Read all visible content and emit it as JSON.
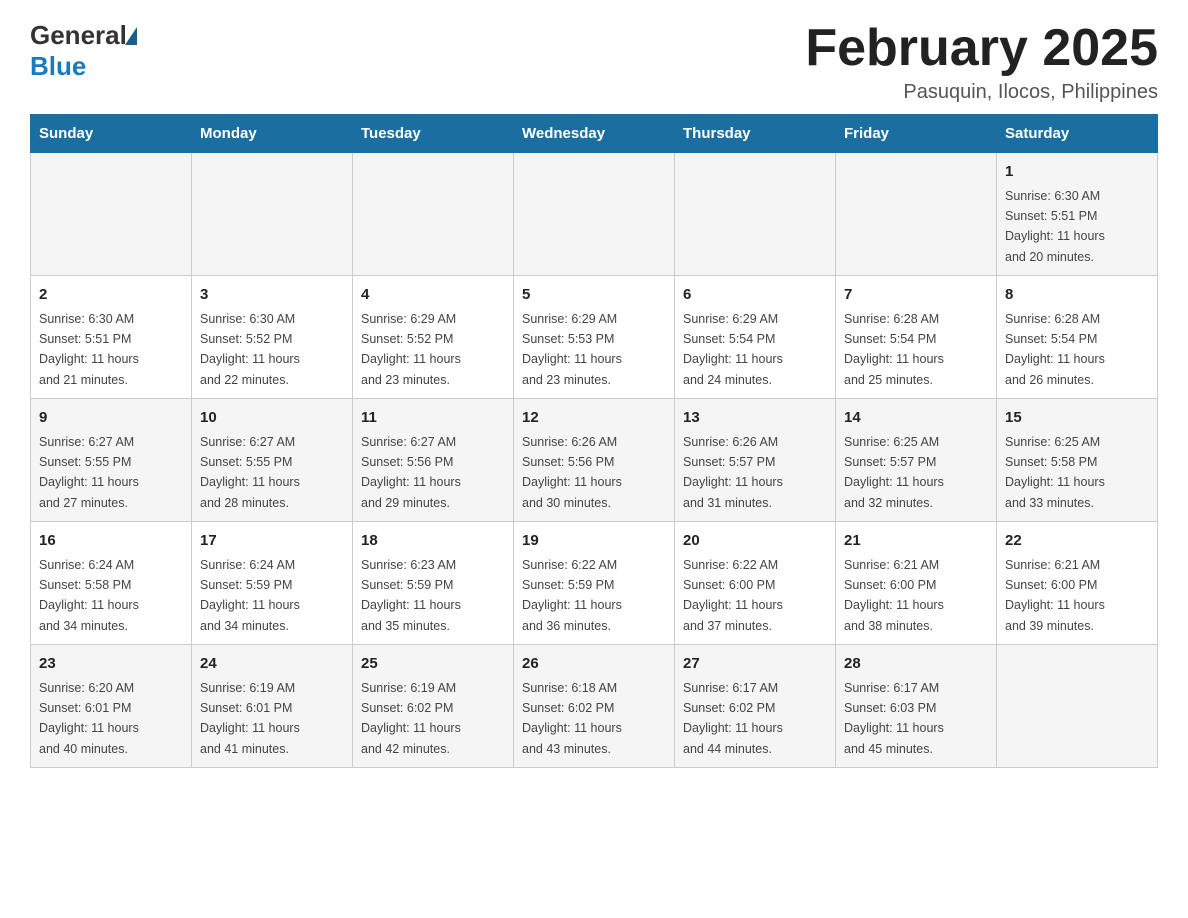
{
  "header": {
    "logo_general": "General",
    "logo_blue": "Blue",
    "month_year": "February 2025",
    "location": "Pasuquin, Ilocos, Philippines"
  },
  "weekdays": [
    "Sunday",
    "Monday",
    "Tuesday",
    "Wednesday",
    "Thursday",
    "Friday",
    "Saturday"
  ],
  "weeks": [
    [
      {
        "day": "",
        "info": ""
      },
      {
        "day": "",
        "info": ""
      },
      {
        "day": "",
        "info": ""
      },
      {
        "day": "",
        "info": ""
      },
      {
        "day": "",
        "info": ""
      },
      {
        "day": "",
        "info": ""
      },
      {
        "day": "1",
        "info": "Sunrise: 6:30 AM\nSunset: 5:51 PM\nDaylight: 11 hours\nand 20 minutes."
      }
    ],
    [
      {
        "day": "2",
        "info": "Sunrise: 6:30 AM\nSunset: 5:51 PM\nDaylight: 11 hours\nand 21 minutes."
      },
      {
        "day": "3",
        "info": "Sunrise: 6:30 AM\nSunset: 5:52 PM\nDaylight: 11 hours\nand 22 minutes."
      },
      {
        "day": "4",
        "info": "Sunrise: 6:29 AM\nSunset: 5:52 PM\nDaylight: 11 hours\nand 23 minutes."
      },
      {
        "day": "5",
        "info": "Sunrise: 6:29 AM\nSunset: 5:53 PM\nDaylight: 11 hours\nand 23 minutes."
      },
      {
        "day": "6",
        "info": "Sunrise: 6:29 AM\nSunset: 5:54 PM\nDaylight: 11 hours\nand 24 minutes."
      },
      {
        "day": "7",
        "info": "Sunrise: 6:28 AM\nSunset: 5:54 PM\nDaylight: 11 hours\nand 25 minutes."
      },
      {
        "day": "8",
        "info": "Sunrise: 6:28 AM\nSunset: 5:54 PM\nDaylight: 11 hours\nand 26 minutes."
      }
    ],
    [
      {
        "day": "9",
        "info": "Sunrise: 6:27 AM\nSunset: 5:55 PM\nDaylight: 11 hours\nand 27 minutes."
      },
      {
        "day": "10",
        "info": "Sunrise: 6:27 AM\nSunset: 5:55 PM\nDaylight: 11 hours\nand 28 minutes."
      },
      {
        "day": "11",
        "info": "Sunrise: 6:27 AM\nSunset: 5:56 PM\nDaylight: 11 hours\nand 29 minutes."
      },
      {
        "day": "12",
        "info": "Sunrise: 6:26 AM\nSunset: 5:56 PM\nDaylight: 11 hours\nand 30 minutes."
      },
      {
        "day": "13",
        "info": "Sunrise: 6:26 AM\nSunset: 5:57 PM\nDaylight: 11 hours\nand 31 minutes."
      },
      {
        "day": "14",
        "info": "Sunrise: 6:25 AM\nSunset: 5:57 PM\nDaylight: 11 hours\nand 32 minutes."
      },
      {
        "day": "15",
        "info": "Sunrise: 6:25 AM\nSunset: 5:58 PM\nDaylight: 11 hours\nand 33 minutes."
      }
    ],
    [
      {
        "day": "16",
        "info": "Sunrise: 6:24 AM\nSunset: 5:58 PM\nDaylight: 11 hours\nand 34 minutes."
      },
      {
        "day": "17",
        "info": "Sunrise: 6:24 AM\nSunset: 5:59 PM\nDaylight: 11 hours\nand 34 minutes."
      },
      {
        "day": "18",
        "info": "Sunrise: 6:23 AM\nSunset: 5:59 PM\nDaylight: 11 hours\nand 35 minutes."
      },
      {
        "day": "19",
        "info": "Sunrise: 6:22 AM\nSunset: 5:59 PM\nDaylight: 11 hours\nand 36 minutes."
      },
      {
        "day": "20",
        "info": "Sunrise: 6:22 AM\nSunset: 6:00 PM\nDaylight: 11 hours\nand 37 minutes."
      },
      {
        "day": "21",
        "info": "Sunrise: 6:21 AM\nSunset: 6:00 PM\nDaylight: 11 hours\nand 38 minutes."
      },
      {
        "day": "22",
        "info": "Sunrise: 6:21 AM\nSunset: 6:00 PM\nDaylight: 11 hours\nand 39 minutes."
      }
    ],
    [
      {
        "day": "23",
        "info": "Sunrise: 6:20 AM\nSunset: 6:01 PM\nDaylight: 11 hours\nand 40 minutes."
      },
      {
        "day": "24",
        "info": "Sunrise: 6:19 AM\nSunset: 6:01 PM\nDaylight: 11 hours\nand 41 minutes."
      },
      {
        "day": "25",
        "info": "Sunrise: 6:19 AM\nSunset: 6:02 PM\nDaylight: 11 hours\nand 42 minutes."
      },
      {
        "day": "26",
        "info": "Sunrise: 6:18 AM\nSunset: 6:02 PM\nDaylight: 11 hours\nand 43 minutes."
      },
      {
        "day": "27",
        "info": "Sunrise: 6:17 AM\nSunset: 6:02 PM\nDaylight: 11 hours\nand 44 minutes."
      },
      {
        "day": "28",
        "info": "Sunrise: 6:17 AM\nSunset: 6:03 PM\nDaylight: 11 hours\nand 45 minutes."
      },
      {
        "day": "",
        "info": ""
      }
    ]
  ]
}
